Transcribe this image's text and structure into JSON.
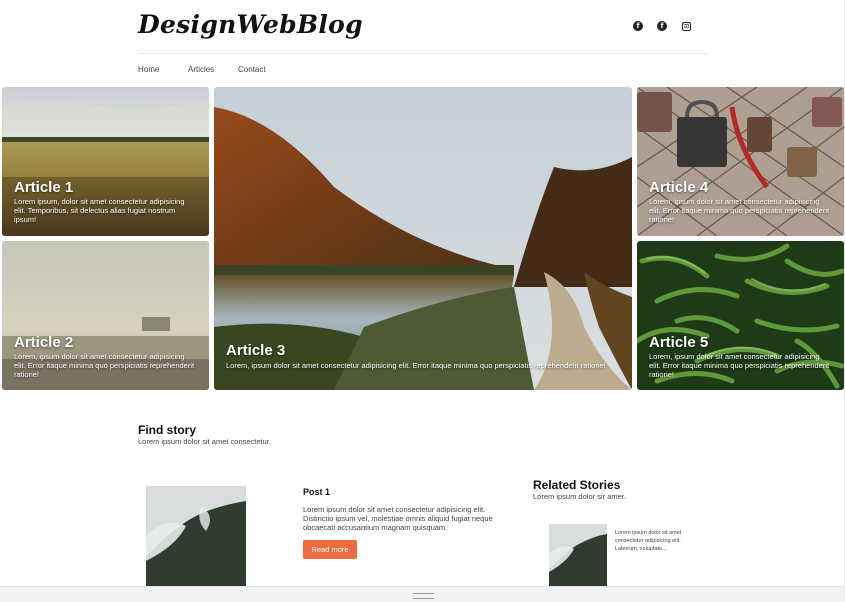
{
  "header": {
    "logo": "DesignWebBlog",
    "social": [
      {
        "icon": "facebook-icon",
        "glyph": "f"
      },
      {
        "icon": "facebook-icon",
        "glyph": "f"
      },
      {
        "icon": "instagram-icon",
        "glyph": "⊡"
      }
    ]
  },
  "nav": {
    "items": [
      "Home",
      "Articles",
      "Contact"
    ]
  },
  "articles": [
    {
      "title": "Article 1",
      "desc": "Lorem ipsum, dolor sit amet consectetur adipisicing elit. Temporibus, sit delectus alias fugiat nostrum ipsum!"
    },
    {
      "title": "Article 2",
      "desc": "Lorem, ipsum dolor sit amet consectetur adipisicing elit. Error itaque minima quo perspiciatis reprehenderit ratione!"
    },
    {
      "title": "Article 3",
      "desc": "Lorem, ipsum dolor sit amet consectetur adipisicing elit. Error itaque minima quo perspiciatis reprehenderit ratione!"
    },
    {
      "title": "Article 4",
      "desc": "Lorem, ipsum dolor sit amet consectetur adipisicing elit. Error itaque minima quo perspiciatis reprehenderit ratione!"
    },
    {
      "title": "Article 5",
      "desc": "Lorem, ipsum dolor sit amet consectetur adipisicing elit. Error itaque minima quo perspiciatis reprehenderit ratione!"
    }
  ],
  "find_story": {
    "title": "Find story",
    "subtitle": "Lorem ipsum dolor sit amet consectetur."
  },
  "post": {
    "title": "Post 1",
    "text": "Lorem ipsum dolor sit amet consectetur adipisicing elit. Distinctio ipsum vel, molestiae omnis aliquid fugiat neque obcaecati accusantium magnam quisquam.",
    "button": "Read more"
  },
  "related": {
    "title": "Related Stories",
    "subtitle": "Lorem ipsum dolor sir amer.",
    "item_text": "Lorem ipsum dolor sit amet consectetur adipisicing elit. Laborum, voluptate..."
  },
  "colors": {
    "accent": "#ee6a3f",
    "text": "#222222"
  }
}
